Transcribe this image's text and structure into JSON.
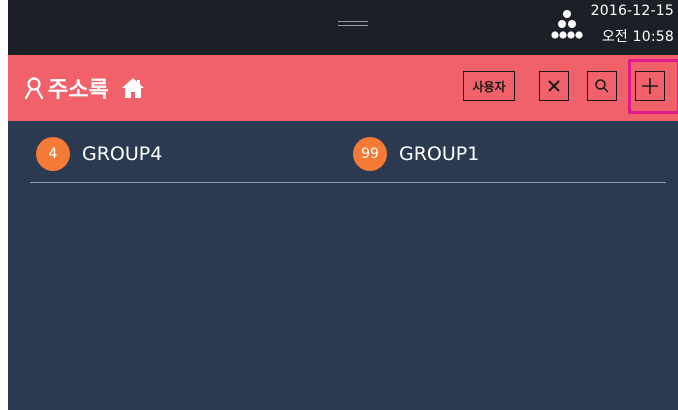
{
  "status_bar": {
    "date": "2016-12-15",
    "time": "오전 10:58",
    "network_icon": "network-dots-icon",
    "handle_icon": "drag-handle-icon"
  },
  "header": {
    "title": "주소록",
    "title_icon": "person-icon",
    "home_icon": "home-icon",
    "user_button_label": "사용자",
    "close_icon": "close-icon",
    "search_icon": "search-icon",
    "add_icon": "plus-icon",
    "background_color": "#f0616a",
    "highlight_color": "#e0198f"
  },
  "groups": [
    {
      "count": "4",
      "name": "GROUP4"
    },
    {
      "count": "99",
      "name": "GROUP1"
    }
  ],
  "colors": {
    "content_background": "#2b3a50",
    "badge": "#f47a36",
    "status_bar": "#1c1f26"
  }
}
